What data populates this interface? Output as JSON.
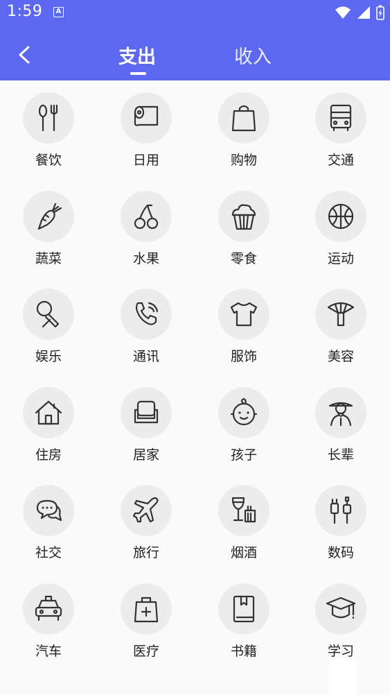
{
  "status_bar": {
    "time": "1:59",
    "notification_icon_label": "A"
  },
  "header": {
    "tabs": [
      {
        "label": "支出"
      },
      {
        "label": "收入"
      }
    ],
    "active_tab": "支出"
  },
  "categories": [
    {
      "label": "餐饮",
      "icon": "fork-spoon-icon"
    },
    {
      "label": "日用",
      "icon": "tissue-roll-icon"
    },
    {
      "label": "购物",
      "icon": "shopping-bag-icon"
    },
    {
      "label": "交通",
      "icon": "bus-icon"
    },
    {
      "label": "蔬菜",
      "icon": "carrot-icon"
    },
    {
      "label": "水果",
      "icon": "cherry-icon"
    },
    {
      "label": "零食",
      "icon": "cupcake-icon"
    },
    {
      "label": "运动",
      "icon": "basketball-icon"
    },
    {
      "label": "娱乐",
      "icon": "microphone-icon"
    },
    {
      "label": "通讯",
      "icon": "phone-icon"
    },
    {
      "label": "服饰",
      "icon": "tshirt-icon"
    },
    {
      "label": "美容",
      "icon": "makeup-brush-icon"
    },
    {
      "label": "住房",
      "icon": "house-icon"
    },
    {
      "label": "居家",
      "icon": "sofa-icon"
    },
    {
      "label": "孩子",
      "icon": "baby-face-icon"
    },
    {
      "label": "长辈",
      "icon": "elder-icon"
    },
    {
      "label": "社交",
      "icon": "chat-bubbles-icon"
    },
    {
      "label": "旅行",
      "icon": "airplane-icon"
    },
    {
      "label": "烟酒",
      "icon": "wine-cigarette-icon"
    },
    {
      "label": "数码",
      "icon": "cable-plug-icon"
    },
    {
      "label": "汽车",
      "icon": "car-icon"
    },
    {
      "label": "医疗",
      "icon": "medical-kit-icon"
    },
    {
      "label": "书籍",
      "icon": "book-icon"
    },
    {
      "label": "学习",
      "icon": "graduation-cap-icon"
    }
  ],
  "colors": {
    "header_bg": "#5c68f0",
    "circle_bg": "#ececec",
    "icon_stroke": "#333333",
    "page_bg": "#fafafa"
  }
}
